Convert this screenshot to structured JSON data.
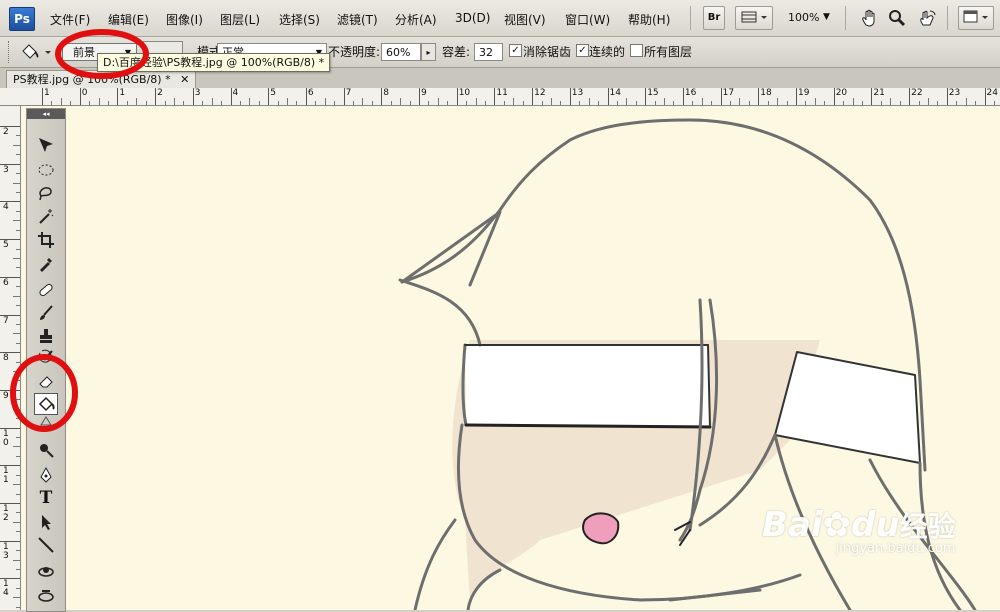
{
  "app": {
    "logo": "Ps"
  },
  "menu": [
    {
      "label": "文件(F)"
    },
    {
      "label": "编辑(E)"
    },
    {
      "label": "图像(I)"
    },
    {
      "label": "图层(L)"
    },
    {
      "label": "选择(S)"
    },
    {
      "label": "滤镜(T)"
    },
    {
      "label": "分析(A)"
    },
    {
      "label": "3D(D)"
    },
    {
      "label": "视图(V)"
    },
    {
      "label": "窗口(W)"
    },
    {
      "label": "帮助(H)"
    }
  ],
  "menubar_tools": {
    "bridge": "Br",
    "zoom": "100%"
  },
  "options": {
    "fill_source": "前景",
    "mode_label": "模式:",
    "mode_value": "正常",
    "opacity_label": "不透明度:",
    "opacity_value": "60%",
    "tolerance_label": "容差:",
    "tolerance_value": "32",
    "antialias_label": "消除锯齿",
    "antialias_checked": true,
    "contiguous_label": "连续的",
    "contiguous_checked": true,
    "all_layers_label": "所有图层",
    "all_layers_checked": false
  },
  "tooltip": "D:\\百度经验\\PS教程.jpg @ 100%(RGB/8) *",
  "document_tab": {
    "title": "PS教程.jpg @ 100%(RGB/8) *",
    "close": "✕"
  },
  "ruler": {
    "h_labels": [
      "1",
      "0",
      "1",
      "2",
      "3",
      "4",
      "5",
      "6",
      "7",
      "8",
      "9",
      "10",
      "11",
      "12",
      "13",
      "14",
      "15",
      "16",
      "17",
      "18",
      "19",
      "20",
      "21",
      "22",
      "23",
      "24"
    ],
    "v_labels": [
      "2",
      "3",
      "4",
      "5",
      "6",
      "7",
      "8",
      "9",
      "10",
      "11",
      "12",
      "13",
      "14"
    ]
  },
  "toolbox": {
    "header": "◂◂",
    "tools": [
      {
        "name": "move-tool",
        "icon": "move-icon",
        "selected": false
      },
      {
        "name": "marquee-tool",
        "icon": "ellipse-marquee-icon",
        "selected": false
      },
      {
        "name": "lasso-tool",
        "icon": "lasso-icon",
        "selected": false
      },
      {
        "name": "magic-wand-tool",
        "icon": "magic-wand-icon",
        "selected": false
      },
      {
        "name": "crop-tool",
        "icon": "crop-icon",
        "selected": false
      },
      {
        "name": "eyedropper-tool",
        "icon": "eyedropper-icon",
        "selected": false
      },
      {
        "name": "healing-brush-tool",
        "icon": "bandage-icon",
        "selected": false
      },
      {
        "name": "brush-tool",
        "icon": "brush-icon",
        "selected": false
      },
      {
        "name": "clone-stamp-tool",
        "icon": "stamp-icon",
        "selected": false
      },
      {
        "name": "history-brush-tool",
        "icon": "history-brush-icon",
        "selected": false
      },
      {
        "name": "eraser-tool",
        "icon": "eraser-icon",
        "selected": false
      },
      {
        "name": "paint-bucket-tool",
        "icon": "paint-bucket-icon",
        "selected": true
      },
      {
        "name": "dodge-tool",
        "icon": "dodge-icon",
        "selected": false
      },
      {
        "name": "pen-tool",
        "icon": "pen-icon",
        "selected": false
      },
      {
        "name": "type-tool",
        "icon": "type-icon",
        "selected": false,
        "glyph": "T"
      },
      {
        "name": "path-selection-tool",
        "icon": "arrow-icon",
        "selected": false
      },
      {
        "name": "line-tool",
        "icon": "line-icon",
        "selected": false
      },
      {
        "name": "3d-rotate-tool",
        "icon": "3d-rotate-icon",
        "selected": false
      },
      {
        "name": "3d-orbit-tool",
        "icon": "3d-orbit-icon",
        "selected": false
      }
    ]
  },
  "watermark": {
    "brand": "Bai",
    "brand2": "du",
    "tag": "经验",
    "url": "jingyan.baidu.com"
  },
  "colors": {
    "canvas": "#fcf8e2",
    "annotation": "#e01010",
    "skin": "#f0e3cf",
    "band": "#ffffff",
    "mouth": "#ef9fbc"
  }
}
